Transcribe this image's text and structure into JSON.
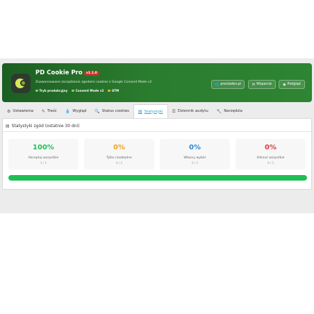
{
  "header": {
    "title": "PD Cookie Pro",
    "version": "v1.1.0",
    "subtitle": "Zaawansowane zarządzanie zgodami cookies z Google Consent Mode v2",
    "status": [
      {
        "label": "Tryb produkcyjny",
        "color": "#7ddc6a"
      },
      {
        "label": "Consent Mode v2",
        "color": "#7ddc6a"
      },
      {
        "label": "GTM",
        "color": "#f5b533"
      }
    ],
    "buttons": [
      {
        "label": "prestadev.pl",
        "icon": "globe-icon"
      },
      {
        "label": "Wsparcie",
        "icon": "envelope-icon"
      },
      {
        "label": "Podgląd",
        "icon": "eye-icon"
      }
    ]
  },
  "tabs": [
    {
      "label": "Ustawienia",
      "icon": "gears-icon"
    },
    {
      "label": "Treść",
      "icon": "edit-icon"
    },
    {
      "label": "Wygląd",
      "icon": "tint-icon"
    },
    {
      "label": "Status cookies",
      "icon": "search-icon"
    },
    {
      "label": "Statystyki",
      "icon": "chart-icon",
      "active": true
    },
    {
      "label": "Dziennik audytu",
      "icon": "list-icon"
    },
    {
      "label": "Narzędzia",
      "icon": "wrench-icon"
    }
  ],
  "stats": {
    "title": "Statystyki zgód (ostatnie 30 dni)",
    "items": [
      {
        "percent": "100%",
        "label": "Akceptuj wszystkie",
        "count": "3 / 3",
        "color": "#1fbf55"
      },
      {
        "percent": "0%",
        "label": "Tylko niezbędne",
        "count": "0 / 3",
        "color": "#f0a31b"
      },
      {
        "percent": "0%",
        "label": "Własny wybór",
        "count": "0 / 3",
        "color": "#2f86d6"
      },
      {
        "percent": "0%",
        "label": "Odrzuć wszystkie",
        "count": "0 / 3",
        "color": "#dd3b3b"
      }
    ],
    "progress_fraction": 1.0,
    "progress_color": "#1fbf55"
  }
}
